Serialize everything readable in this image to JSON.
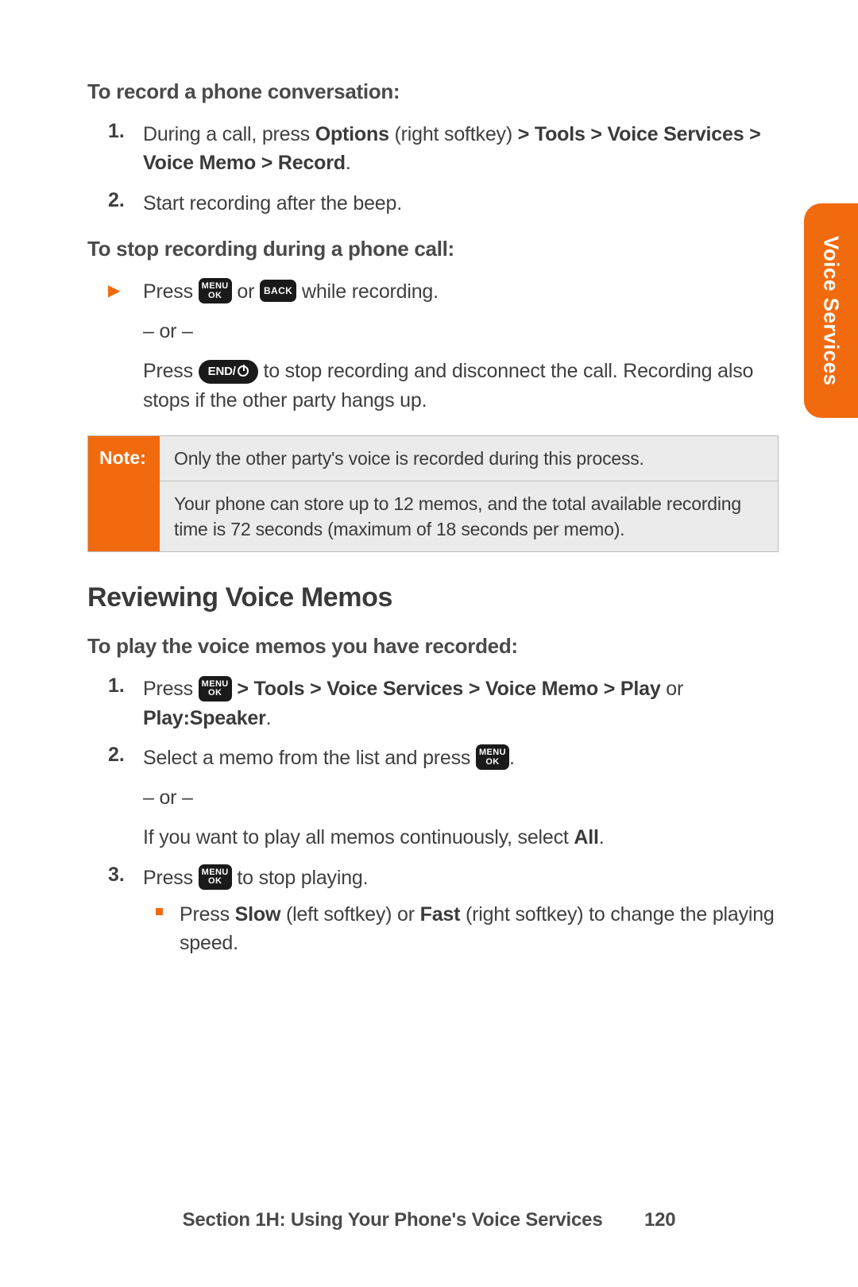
{
  "side_tab": "Voice Services",
  "sec1": {
    "heading": "To record a phone conversation:",
    "step1_a": "During a call, press ",
    "step1_b": "Options",
    "step1_c": " (right softkey) ",
    "step1_d": "> Tools > Voice Services > Voice Memo > Record",
    "step1_e": ".",
    "step2": "Start recording after the beep."
  },
  "sec2": {
    "heading": "To stop recording during a phone call:",
    "line1_a": "Press ",
    "line1_b": " or ",
    "line1_c": " while recording.",
    "or": "– or –",
    "line2_a": "Press ",
    "line2_b": " to stop recording and disconnect the call. Recording also stops if the other party hangs up."
  },
  "note": {
    "label": "Note:",
    "row1": "Only the other party's voice is recorded during this process.",
    "row2": "Your phone can store up to 12 memos, and the total available recording time is 72 seconds (maximum of 18 seconds per memo)."
  },
  "h2": "Reviewing Voice Memos",
  "sec3": {
    "heading": "To play the voice memos you have recorded:",
    "s1_a": "Press ",
    "s1_b": " > Tools > Voice Services > Voice Memo > Play",
    "s1_c": " or ",
    "s1_d": "Play:Speaker",
    "s1_e": ".",
    "s2_a": "Select a memo from the list and press ",
    "s2_b": ".",
    "or": "– or –",
    "s2_c": "If you want to play all memos continuously, select ",
    "s2_d": "All",
    "s2_e": ".",
    "s3_a": "Press ",
    "s3_b": " to stop playing.",
    "sub_a": "Press ",
    "sub_b": "Slow",
    "sub_c": " (left softkey) or ",
    "sub_d": "Fast",
    "sub_e": " (right softkey) to change the playing speed."
  },
  "keys": {
    "menu_l1": "MENU",
    "menu_l2": "OK",
    "back": "BACK",
    "end": "END/"
  },
  "footer": {
    "section": "Section 1H: Using Your Phone's Voice Services",
    "page": "120"
  }
}
